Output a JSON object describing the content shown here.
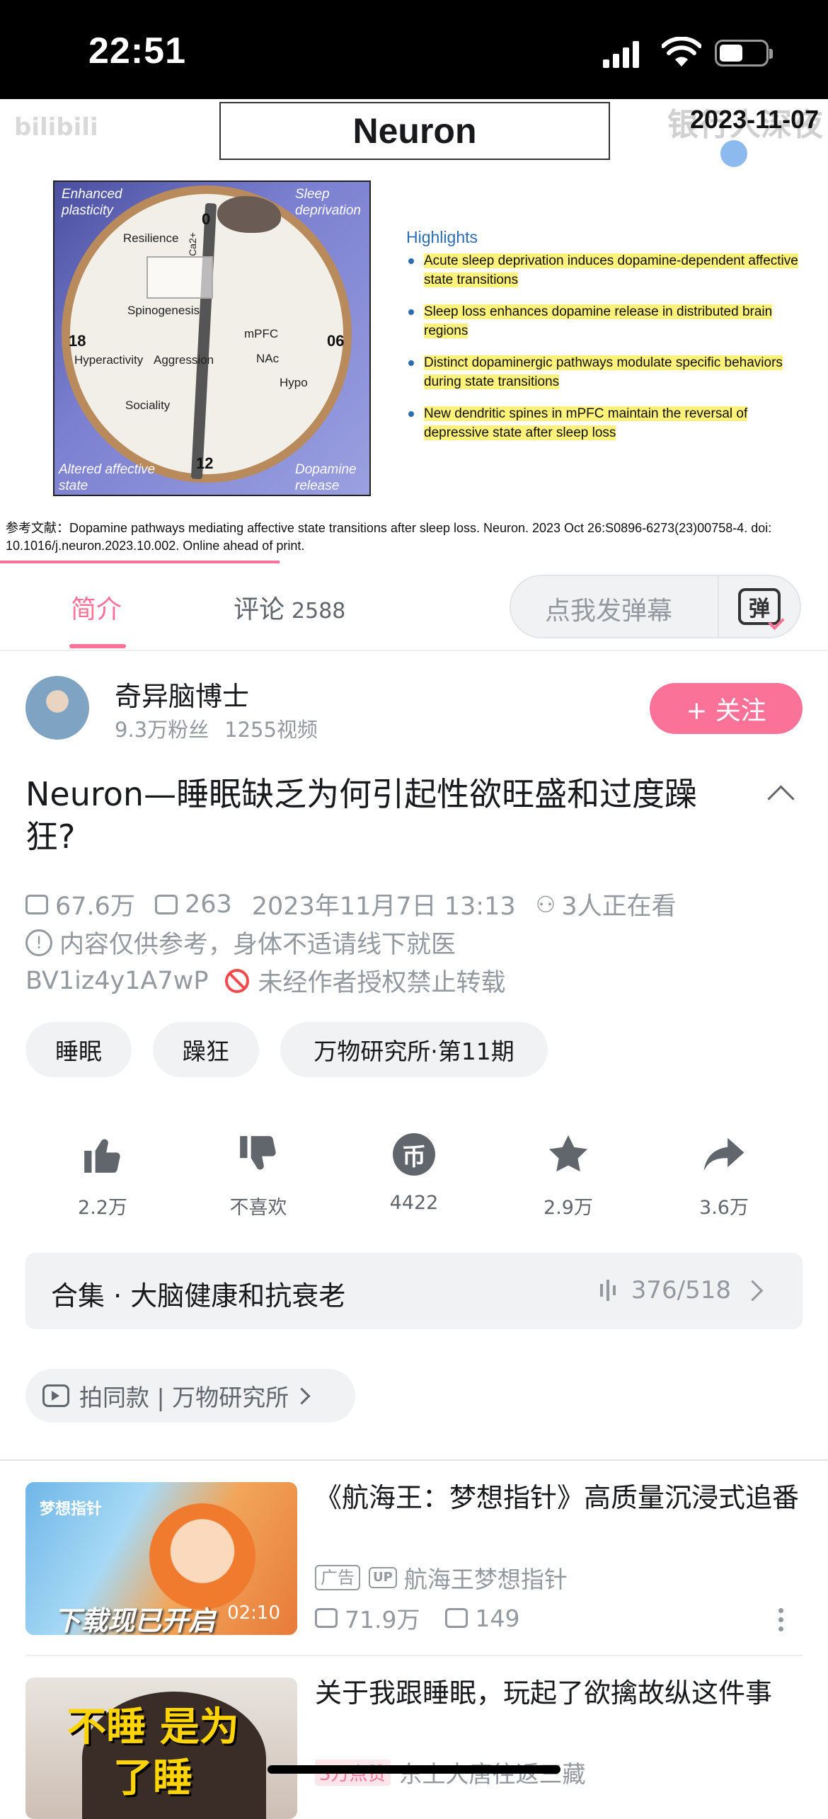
{
  "status_bar": {
    "time": "22:51"
  },
  "video": {
    "journal": "Neuron",
    "date": "2023-11-07",
    "watermark": "银行人深夜",
    "left_watermark": "bilibili",
    "figure": {
      "corner_labels": [
        "Enhanced plasticity",
        "Sleep deprivation",
        "Altered affective state",
        "Dopamine release"
      ],
      "inner_labels": [
        "Resilience",
        "Spinogenesis",
        "Hyperactivity",
        "Aggression",
        "Sociality",
        "mPFC",
        "NAc",
        "Hypo",
        "Ca2+"
      ],
      "hours": [
        "0",
        "06",
        "12",
        "18"
      ]
    },
    "highlights_title": "Highlights",
    "highlights": [
      "Acute sleep deprivation induces dopamine-dependent affective state transitions",
      "Sleep loss enhances dopamine release in distributed brain regions",
      "Distinct dopaminergic pathways modulate specific behaviors during state transitions",
      "New dendritic spines in mPFC maintain the reversal of depressive state after sleep loss"
    ],
    "reference": "参考文献：Dopamine pathways mediating affective state transitions after sleep loss. Neuron. 2023 Oct 26:S0896-6273(23)00758-4. doi: 10.1016/j.neuron.2023.10.002. Online ahead of print."
  },
  "tabs": {
    "intro": "简介",
    "comments": "评论",
    "comments_count": "2588",
    "danmaku_placeholder": "点我发弹幕",
    "danmaku_icon": "弹"
  },
  "uploader": {
    "name": "奇异脑博士",
    "fans": "9.3万粉丝",
    "videos": "1255视频",
    "follow_label": "+ 关注"
  },
  "video_info": {
    "title": "Neuron—睡眠缺乏为何引起性欲旺盛和过度躁狂?",
    "views": "67.6万",
    "danmaku": "263",
    "datetime": "2023年11月7日 13:13",
    "watching": "3人正在看",
    "notice": "内容仅供参考，身体不适请线下就医",
    "bvid": "BV1iz4y1A7wP",
    "copyright": "未经作者授权禁止转载",
    "tags": [
      "睡眠",
      "躁狂",
      "万物研究所·第11期"
    ]
  },
  "actions": [
    {
      "icon": "thumbs-up-icon",
      "label": "2.2万"
    },
    {
      "icon": "thumbs-down-icon",
      "label": "不喜欢"
    },
    {
      "icon": "coin-icon",
      "label": "4422"
    },
    {
      "icon": "star-icon",
      "label": "2.9万"
    },
    {
      "icon": "share-icon",
      "label": "3.6万"
    }
  ],
  "collection": {
    "name": "合集 · 大脑健康和抗衰老",
    "progress": "376/518"
  },
  "same_style": "拍同款 | 万物研究所",
  "related": [
    {
      "title": "《航海王：梦想指针》高质量沉浸式追番",
      "ad_tag": "广告",
      "up_tag": "UP",
      "author": "航海王梦想指针",
      "views": "71.9万",
      "danmaku": "149",
      "duration": "02:10",
      "thumb_text": "下载现已开启",
      "thumb_logo": "梦想指针"
    },
    {
      "title": "关于我跟睡眠，玩起了欲擒故纵这件事",
      "badge": "3万点赞",
      "author": "东土大唐往返三藏",
      "thumb_text": "不睡 是为了睡"
    }
  ],
  "colors": {
    "accent": "#fb7299",
    "text": "#18191c",
    "muted": "#9499a0",
    "highlight": "#fff27a"
  }
}
